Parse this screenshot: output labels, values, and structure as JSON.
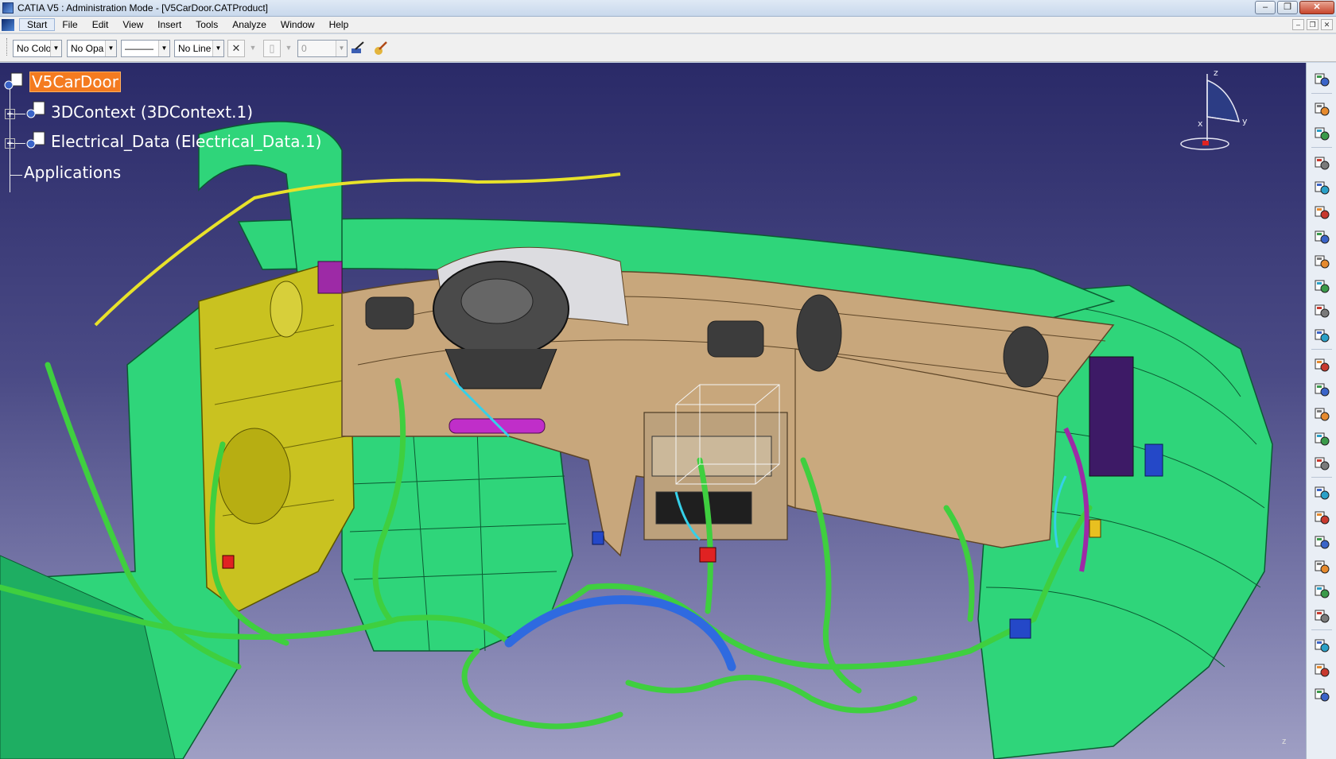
{
  "window": {
    "title": "CATIA V5 : Administration Mode - [V5CarDoor.CATProduct]",
    "minimize_glyph": "–",
    "restore_glyph": "❐",
    "close_glyph": "✕"
  },
  "menu": {
    "items": [
      "Start",
      "File",
      "Edit",
      "View",
      "Insert",
      "Tools",
      "Analyze",
      "Window",
      "Help"
    ],
    "active": "Start",
    "doc_buttons": [
      "–",
      "❐",
      "✕"
    ]
  },
  "toolbar": {
    "color_combo": "No Colo",
    "opacity_combo": "No Opa",
    "line_combo": "No Line",
    "line_style_combo": "———",
    "weight_value": "0",
    "clear_glyph": "✕"
  },
  "tree": {
    "root": "V5CarDoor",
    "children": [
      "3DContext (3DContext.1)",
      "Electrical_Data (Electrical_Data.1)"
    ],
    "applications": "Applications"
  },
  "compass": {
    "x_label": "x",
    "y_label": "y",
    "z_label": "z"
  },
  "viewport": {
    "corner_axis_label": "z"
  },
  "colors": {
    "viewport_top": "#2a2a68",
    "viewport_bottom": "#9f9fc4",
    "root_highlight": "#f47b20",
    "harness_green": "#3fcf3f",
    "body_green": "#2fd57a",
    "dash_tan": "#c8a77c",
    "door_yellow": "#c9c220"
  },
  "right_toolbar_icons": [
    "compass-settings-icon",
    "select-arrow-icon",
    "tool-palette-icon",
    "gear-assembly-icon",
    "product-icon",
    "component-icon",
    "insert-existing-icon",
    "replace-component-icon",
    "reorder-icon",
    "generate-numbering-icon",
    "catalog-icon",
    "multi-instantiation-icon",
    "manipulation-icon",
    "snap-icon",
    "explode-icon",
    "stop-manipulation-icon",
    "constraint-icon",
    "coincidence-icon",
    "contact-icon",
    "offset-icon",
    "angle-icon",
    "fix-icon",
    "update-icon",
    "scenes-icon",
    "publication-icon"
  ]
}
